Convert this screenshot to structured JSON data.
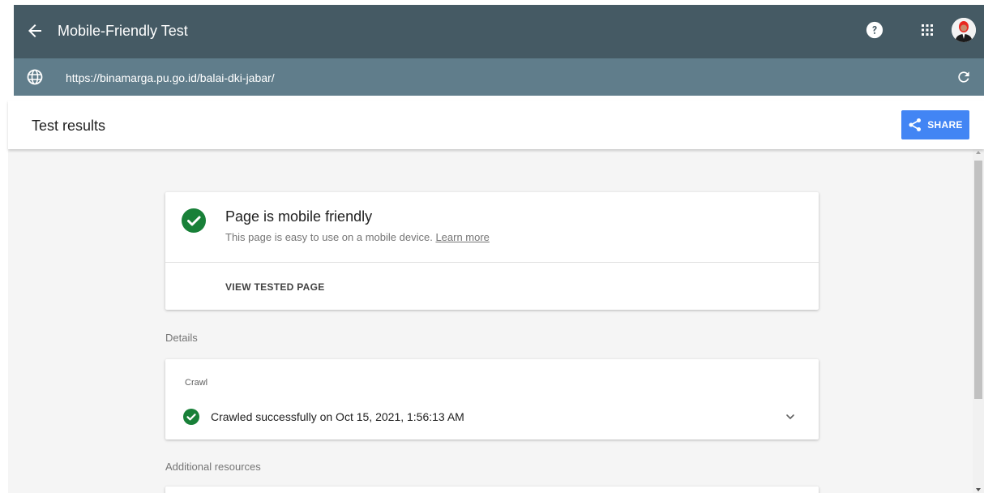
{
  "topbar": {
    "title": "Mobile-Friendly Test",
    "back_icon": "arrow-left-icon",
    "help_icon": "help-circle-icon",
    "apps_icon": "apps-grid-icon",
    "avatar": "user-avatar"
  },
  "urlbar": {
    "url": "https://binamarga.pu.go.id/balai-dki-jabar/",
    "globe_icon": "globe-icon",
    "refresh_icon": "refresh-icon"
  },
  "results": {
    "title": "Test results",
    "share_label": "SHARE"
  },
  "status_card": {
    "title": "Page is mobile friendly",
    "description": "This page is easy to use on a mobile device.",
    "learn_more": "Learn more",
    "view_tested": "VIEW TESTED PAGE"
  },
  "details": {
    "label": "Details",
    "crawl_label": "Crawl",
    "crawl_status": "Crawled successfully on Oct 15, 2021, 1:56:13 AM"
  },
  "additional": {
    "label": "Additional resources"
  },
  "colors": {
    "header": "#455a64",
    "urlbar": "#607d8b",
    "accent": "#4285f4",
    "success": "#188038",
    "background": "#f5f5f5"
  }
}
